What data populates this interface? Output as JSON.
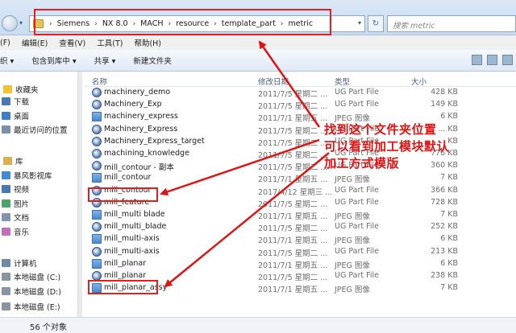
{
  "address": {
    "crumbs": [
      "Siemens",
      "NX 8.0",
      "MACH",
      "resource",
      "template_part",
      "metric"
    ],
    "separator": "›",
    "search_placeholder": "搜索 metric",
    "refresh_glyph": "↻",
    "dropdown_glyph": "▾"
  },
  "menu": [
    "(F)",
    "编辑(E)",
    "查看(V)",
    "工具(T)",
    "帮助(H)"
  ],
  "toolbar": [
    "织 ▾",
    "包含到库中 ▾",
    "共享 ▾",
    "新建文件夹"
  ],
  "nav": [
    {
      "label": "收藏夹",
      "icon": "star-icon"
    },
    {
      "label": "下载",
      "icon": "download-folder-icon"
    },
    {
      "label": "桌面",
      "icon": "desktop-icon"
    },
    {
      "label": "最近访问的位置",
      "icon": "recent-places-icon"
    },
    {
      "label": "库",
      "icon": "library-icon"
    },
    {
      "label": "暴风影视库",
      "icon": "video-library-icon"
    },
    {
      "label": "视频",
      "icon": "video-icon"
    },
    {
      "label": "图片",
      "icon": "pictures-icon"
    },
    {
      "label": "文档",
      "icon": "documents-icon"
    },
    {
      "label": "音乐",
      "icon": "music-icon"
    },
    {
      "label": "计算机",
      "icon": "computer-icon"
    },
    {
      "label": "本地磁盘 (C:)",
      "icon": "drive-icon"
    },
    {
      "label": "本地磁盘 (D:)",
      "icon": "drive-icon"
    },
    {
      "label": "本地磁盘 (E:)",
      "icon": "drive-icon"
    }
  ],
  "columns": {
    "name": "名称",
    "date": "修改日期",
    "type": "类型",
    "size": "大小"
  },
  "files": [
    {
      "name": "machinery_demo",
      "date": "2011/7/5 星期二 ...",
      "type": "UG Part File",
      "size": "428 KB",
      "icon": "ug-part-file-icon"
    },
    {
      "name": "Machinery_Exp",
      "date": "2011/7/5 星期二 ...",
      "type": "UG Part File",
      "size": "149 KB",
      "icon": "ug-part-file-icon"
    },
    {
      "name": "machinery_express",
      "date": "2011/7/1 星期五 ...",
      "type": "JPEG 图像",
      "size": "6 KB",
      "icon": "jpeg-image-icon"
    },
    {
      "name": "Machinery_Express",
      "date": "2011/7/5 星期二 ...",
      "type": "UG Part File",
      "size": "... KB",
      "icon": "ug-part-file-icon"
    },
    {
      "name": "Machinery_Express_target",
      "date": "2011/7/5 星期二 ...",
      "type": "UG Part File",
      "size": "... KB",
      "icon": "ug-part-file-icon"
    },
    {
      "name": "machining_knowledge",
      "date": "2011/7/5 星期二 ...",
      "type": "UG Part File",
      "size": "776 KB",
      "icon": "ug-part-file-icon"
    },
    {
      "name": "mill_contour - 副本",
      "date": "2011/7/5 星期二 ...",
      "type": "UG Part File",
      "size": "360 KB",
      "icon": "ug-part-file-icon"
    },
    {
      "name": "mill_contour",
      "date": "2011/7/1 星期五 ...",
      "type": "JPEG 图像",
      "size": "7 KB",
      "icon": "jpeg-image-icon"
    },
    {
      "name": "mill_contour",
      "date": "2017/4/12 星期三 ...",
      "type": "UG Part File",
      "size": "366 KB",
      "icon": "ug-part-file-icon"
    },
    {
      "name": "mill_feature",
      "date": "2011/7/5 星期二 ...",
      "type": "UG Part File",
      "size": "728 KB",
      "icon": "ug-part-file-icon"
    },
    {
      "name": "mill_multi blade",
      "date": "2011/7/1 星期五 ...",
      "type": "JPEG 图像",
      "size": "7 KB",
      "icon": "jpeg-image-icon"
    },
    {
      "name": "mill_multi_blade",
      "date": "2011/7/5 星期二 ...",
      "type": "UG Part File",
      "size": "252 KB",
      "icon": "ug-part-file-icon"
    },
    {
      "name": "mill_multi-axis",
      "date": "2011/7/1 星期五 ...",
      "type": "JPEG 图像",
      "size": "6 KB",
      "icon": "jpeg-image-icon"
    },
    {
      "name": "mill_multi-axis",
      "date": "2011/7/5 星期二 ...",
      "type": "UG Part File",
      "size": "213 KB",
      "icon": "ug-part-file-icon"
    },
    {
      "name": "mill_planar",
      "date": "2011/7/1 星期五 ...",
      "type": "JPEG 图像",
      "size": "6 KB",
      "icon": "jpeg-image-icon"
    },
    {
      "name": "mill_planar",
      "date": "2011/7/5 星期二 ...",
      "type": "UG Part File",
      "size": "238 KB",
      "icon": "ug-part-file-icon"
    },
    {
      "name": "mill_planar_assy",
      "date": "2011/7/1 星期五 ...",
      "type": "JPEG 图像",
      "size": "7 KB",
      "icon": "jpeg-image-icon"
    }
  ],
  "status": {
    "count": "56 个对象"
  },
  "annotation": {
    "lines": [
      "找到这个文件夹位置",
      "可以看到加工模块默认",
      "加工方式模版"
    ],
    "color": "#e01414"
  }
}
